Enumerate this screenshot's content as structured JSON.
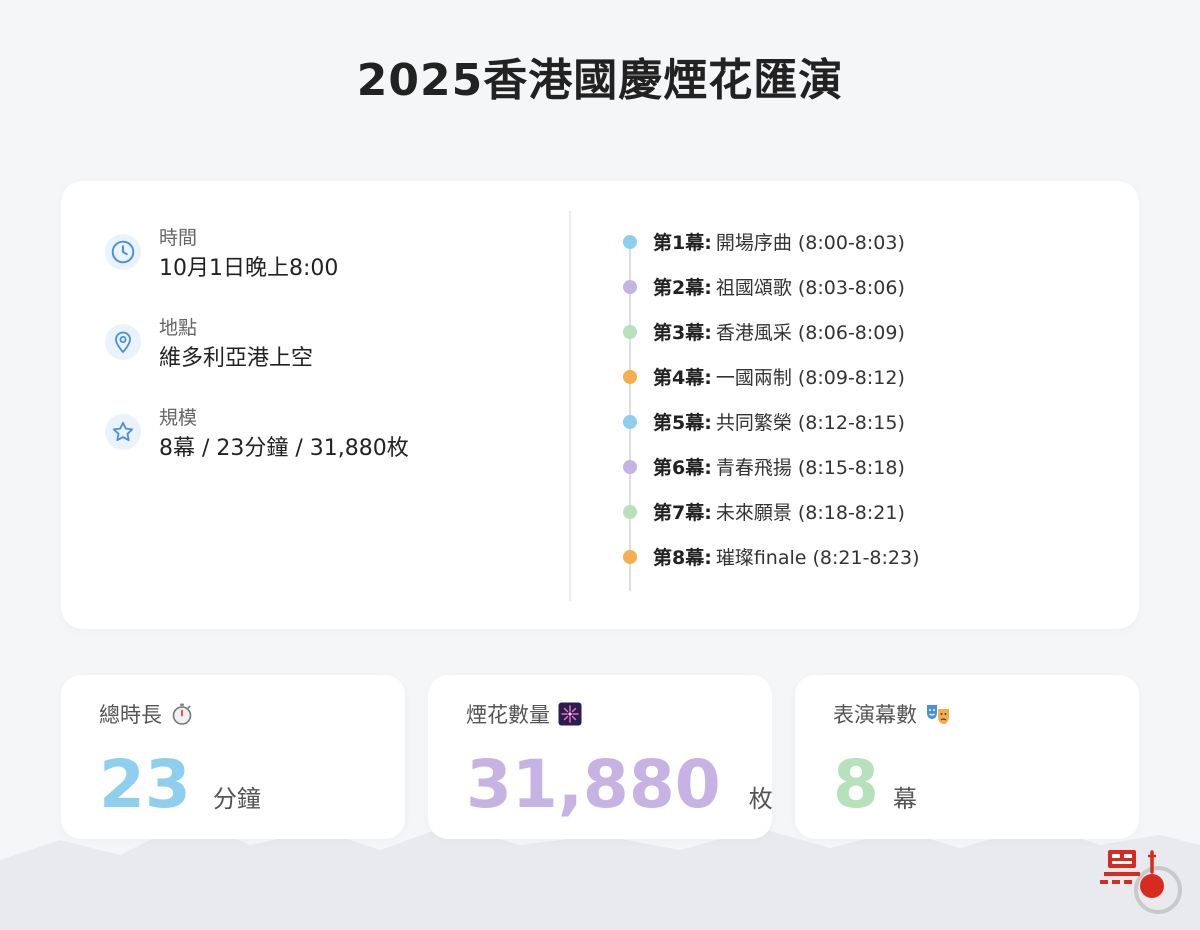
{
  "title": "2025香港國慶煙花匯演",
  "info": {
    "time_label": "時間",
    "time_value": "10月1日晚上8:00",
    "place_label": "地點",
    "place_value": "維多利亞港上空",
    "scale_label": "規模",
    "scale_value": "8幕 / 23分鐘 / 31,880枚"
  },
  "acts": [
    {
      "act": "第1幕:",
      "name": "開場序曲 (8:00-8:03)",
      "color": "#8ecff0"
    },
    {
      "act": "第2幕:",
      "name": "祖國頌歌 (8:03-8:06)",
      "color": "#c6b3e3"
    },
    {
      "act": "第3幕:",
      "name": "香港風采 (8:06-8:09)",
      "color": "#b6e2bb"
    },
    {
      "act": "第4幕:",
      "name": "一國兩制 (8:09-8:12)",
      "color": "#f6ad4e"
    },
    {
      "act": "第5幕:",
      "name": "共同繁榮 (8:12-8:15)",
      "color": "#8ecff0"
    },
    {
      "act": "第6幕:",
      "name": "青春飛揚 (8:15-8:18)",
      "color": "#c6b3e3"
    },
    {
      "act": "第7幕:",
      "name": "未來願景 (8:18-8:21)",
      "color": "#b6e2bb"
    },
    {
      "act": "第8幕:",
      "name": "璀璨finale (8:21-8:23)",
      "color": "#f6ad4e"
    }
  ],
  "stats": {
    "duration_label": "總時長",
    "duration_icon": "stopwatch-icon",
    "duration_value": "23",
    "duration_unit": "分鐘",
    "duration_color": "#8ecff0",
    "fireworks_label": "煙花數量",
    "fireworks_icon": "firework-icon",
    "fireworks_value": "31,880",
    "fireworks_unit": "枚",
    "fireworks_color": "#c6b3e3",
    "acts_label": "表演幕數",
    "acts_icon": "theater-masks-icon",
    "acts_value": "8",
    "acts_unit": "幕",
    "acts_color": "#b6e2bb"
  },
  "colors": {
    "accent_blue": "#4a8fd9",
    "logo_red": "#d82a1e"
  }
}
